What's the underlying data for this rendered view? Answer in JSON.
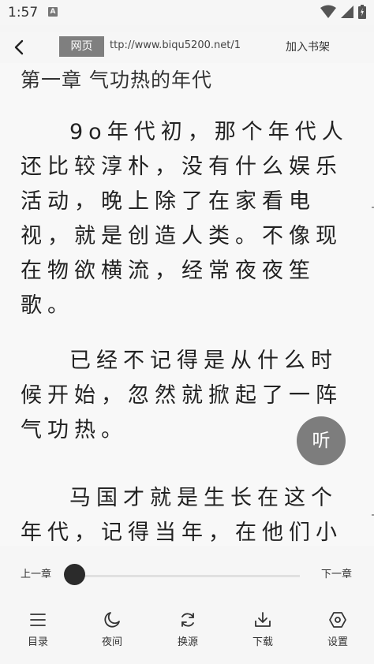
{
  "status_bar": {
    "time": "1:57",
    "notification": "A",
    "icons": [
      "wifi-icon",
      "signal-icon",
      "battery-icon"
    ]
  },
  "top_bar": {
    "back_icon": "chevron-left-icon",
    "web_label": "网页",
    "url": "ttp://www.biqu5200.net/1",
    "add_shelf_label": "加入书架"
  },
  "reader": {
    "chapter_title": "第一章 气功热的年代",
    "paragraphs": [
      "9o年代初，那个年代人还比较淳朴，没有什么娱乐活动，晚上除了在家看电视，就是创造人类。不像现在物欲横流，经常夜夜笙歌。",
      "已经不记得是从什么时候开始，忽然就掀起了一阵气功热。",
      "马国才就是生长在这个年代，记得当年，在他们小镇上"
    ],
    "listen_label": "听"
  },
  "progress": {
    "prev_label": "上一章",
    "next_label": "下一章",
    "position_fraction": 0.0
  },
  "bottom_nav": {
    "items": [
      {
        "label": "目录",
        "icon": "menu-icon"
      },
      {
        "label": "夜间",
        "icon": "moon-icon"
      },
      {
        "label": "换源",
        "icon": "refresh-icon"
      },
      {
        "label": "下载",
        "icon": "download-icon"
      },
      {
        "label": "设置",
        "icon": "settings-hexagon-icon"
      }
    ]
  },
  "colors": {
    "background": "#f5f5f5",
    "chip": "#7f7f7f",
    "listen_button": "#7d7d7d",
    "thumb": "#2b2b2b",
    "text": "#222222"
  }
}
